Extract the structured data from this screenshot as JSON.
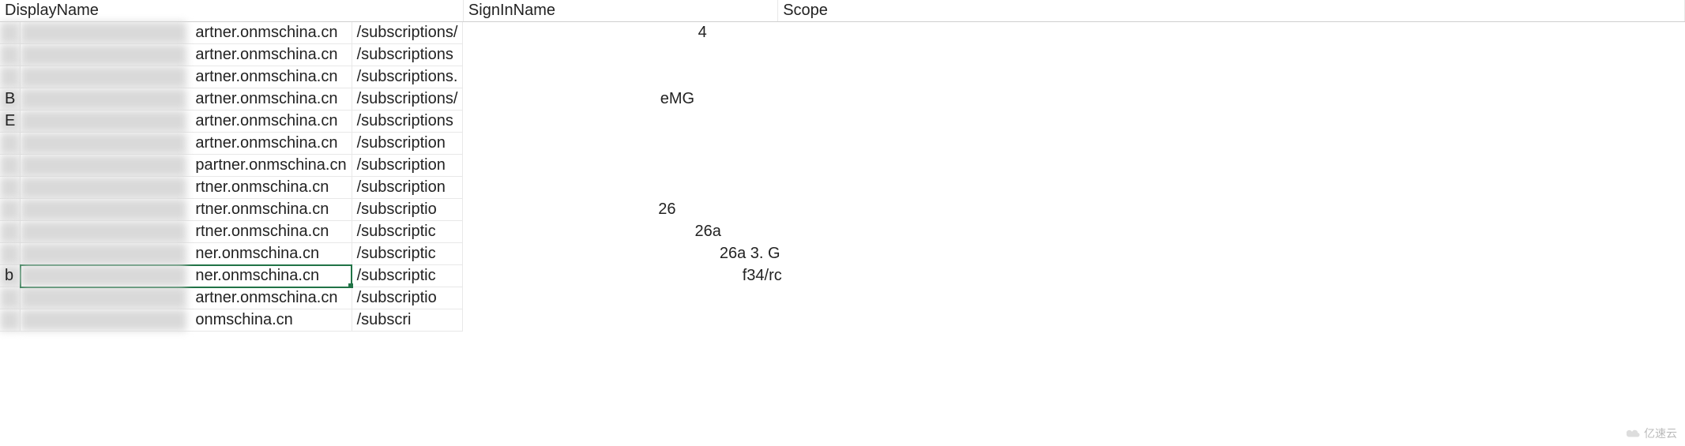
{
  "headers": {
    "display_name": "DisplayName",
    "sign_in_name": "SignInName",
    "scope": "Scope"
  },
  "rows": [
    {
      "display": "",
      "signin_visible": "artner.onmschina.cn",
      "scope_visible": "/subscriptions/",
      "extra": "4"
    },
    {
      "display": "",
      "signin_visible": "artner.onmschina.cn",
      "scope_visible": "/subscriptions",
      "extra": ""
    },
    {
      "display": "",
      "signin_visible": "artner.onmschina.cn",
      "scope_visible": "/subscriptions.",
      "extra": ""
    },
    {
      "display": "B",
      "signin_visible": "artner.onmschina.cn",
      "scope_visible": "/subscriptions/",
      "extra": "eMG"
    },
    {
      "display": "E",
      "signin_visible": "artner.onmschina.cn",
      "scope_visible": "/subscriptions",
      "extra": ""
    },
    {
      "display": "",
      "signin_visible": "artner.onmschina.cn",
      "scope_visible": "/subscription",
      "extra": ""
    },
    {
      "display": "",
      "signin_visible": "partner.onmschina.cn",
      "scope_visible": "/subscription",
      "extra": ""
    },
    {
      "display": "",
      "signin_visible": "rtner.onmschina.cn",
      "scope_visible": "/subscription",
      "extra": ""
    },
    {
      "display": "",
      "signin_visible": "rtner.onmschina.cn",
      "scope_visible": "/subscriptio",
      "extra": "26"
    },
    {
      "display": "",
      "signin_visible": "rtner.onmschina.cn",
      "scope_visible": "/subscriptic",
      "extra": "26a"
    },
    {
      "display": "",
      "signin_visible": "ner.onmschina.cn",
      "scope_visible": "/subscriptic",
      "extra": "26a    3.                G"
    },
    {
      "display": "b",
      "signin_visible": "ner.onmschina.cn",
      "scope_visible": "/subscriptic",
      "extra": "f34/rc",
      "selected": true
    },
    {
      "display": "",
      "signin_visible": "artner.onmschina.cn",
      "scope_visible": "/subscriptio",
      "extra": ""
    },
    {
      "display": "",
      "signin_visible": "onmschina.cn",
      "scope_visible": "/subscri",
      "extra": ""
    }
  ],
  "watermark": "亿速云"
}
